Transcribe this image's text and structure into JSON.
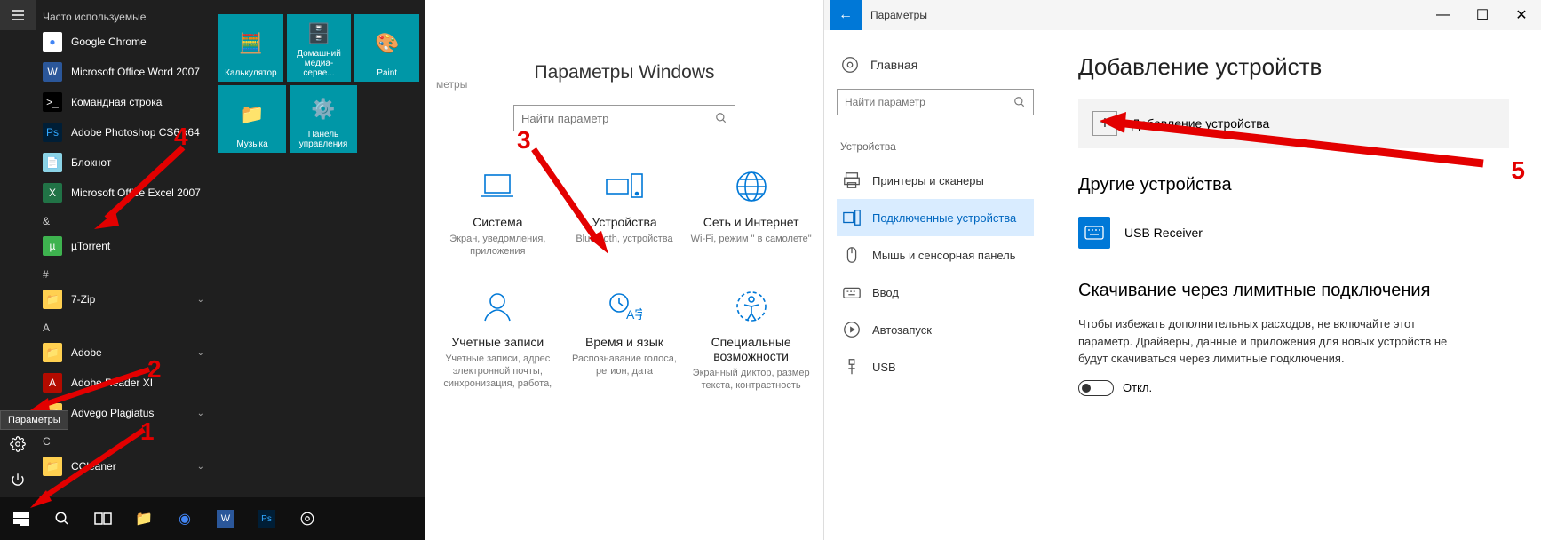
{
  "start": {
    "section_frequent": "Часто используемые",
    "apps": [
      {
        "label": "Google Chrome",
        "color": "#fff",
        "bg": "#4285f4",
        "initial": "G"
      },
      {
        "label": "Microsoft Office Word 2007",
        "color": "#fff",
        "bg": "#2b579a",
        "initial": "W"
      },
      {
        "label": "Командная строка",
        "color": "#fff",
        "bg": "#000",
        "initial": ">"
      },
      {
        "label": "Adobe Photoshop CS6 x64",
        "color": "#fff",
        "bg": "#001e36",
        "initial": "Ps"
      },
      {
        "label": "Блокнот",
        "color": "#333",
        "bg": "#8bd3e6",
        "initial": "📄"
      },
      {
        "label": "Microsoft Office Excel 2007",
        "color": "#fff",
        "bg": "#217346",
        "initial": "X"
      }
    ],
    "letter_amp": "&",
    "utorrent": "µTorrent",
    "letter_hash": "#",
    "sevenzip": "7-Zip",
    "letter_a": "A",
    "adobe": "Adobe",
    "adobe_reader": "Adobe Reader XI",
    "advego": "Advego Plagiatus",
    "letter_c": "C",
    "ccleaner": "CCleaner",
    "tiles": [
      {
        "label": "Калькулятор",
        "emoji": "🧮"
      },
      {
        "label": "Домашний медиа-серве...",
        "emoji": "🗄️"
      },
      {
        "label": "Paint",
        "emoji": "🎨"
      },
      {
        "label": "Музыка",
        "emoji": "📁"
      },
      {
        "label": "Панель управления",
        "emoji": "⚙️"
      }
    ],
    "tooltip": "Параметры"
  },
  "settings_breadcrumb": "метры",
  "settings_home": {
    "title": "Параметры Windows",
    "search_placeholder": "Найти параметр",
    "items": [
      {
        "title": "Система",
        "sub": "Экран, уведомления, приложения"
      },
      {
        "title": "Устройства",
        "sub": "Bluetooth, устройства"
      },
      {
        "title": "Сеть и Интернет",
        "sub": "Wi-Fi, режим \" в самолете\""
      },
      {
        "title": "Учетные записи",
        "sub": "Учетные записи, адрес электронной почты, синхронизация, работа,"
      },
      {
        "title": "Время и язык",
        "sub": "Распознавание голоса, регион, дата"
      },
      {
        "title": "Специальные возможности",
        "sub": "Экранный диктор, размер текста, контрастность"
      }
    ]
  },
  "settings_detail": {
    "titlebar": "Параметры",
    "home": "Главная",
    "search_placeholder": "Найти параметр",
    "category": "Устройства",
    "nav": [
      "Принтеры и сканеры",
      "Подключенные устройства",
      "Мышь и сенсорная панель",
      "Ввод",
      "Автозапуск",
      "USB"
    ],
    "h1": "Добавление устройств",
    "add_device": "Добавление устройства",
    "h2_other": "Другие устройства",
    "usb_receiver": "USB Receiver",
    "h2_metered": "Скачивание через лимитные подключения",
    "metered_text": "Чтобы избежать дополнительных расходов, не включайте этот параметр. Драйверы, данные и приложения для новых устройств не будут скачиваться через лимитные подключения.",
    "toggle_off": "Откл."
  },
  "annotations": {
    "n1": "1",
    "n2": "2",
    "n3": "3",
    "n4": "4",
    "n5": "5"
  }
}
